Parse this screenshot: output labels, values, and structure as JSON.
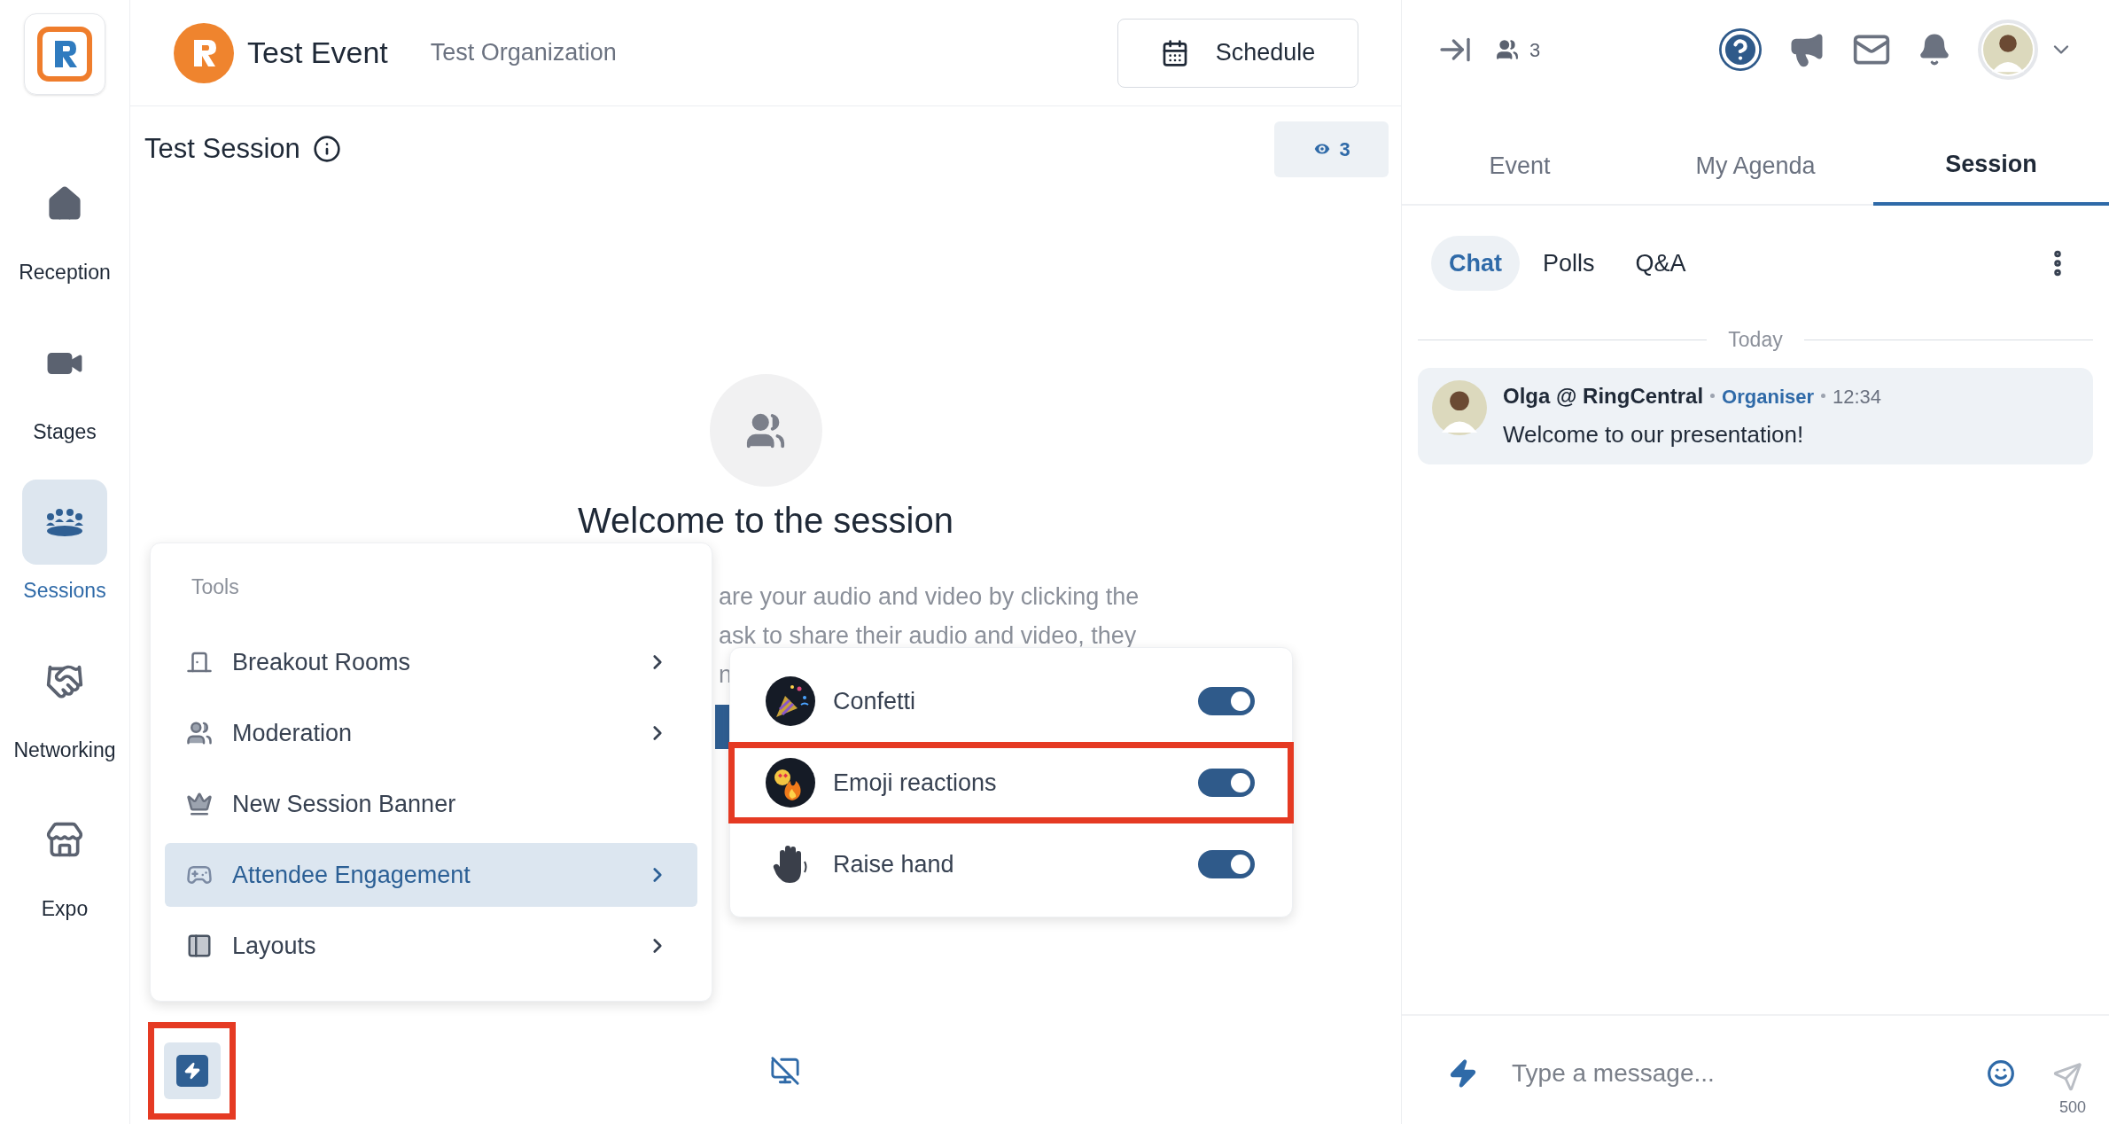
{
  "sidebar": {
    "items": [
      {
        "label": "Reception",
        "kind": "home",
        "selected": false
      },
      {
        "label": "Stages",
        "kind": "video",
        "selected": false
      },
      {
        "label": "Sessions",
        "kind": "sessions",
        "selected": true
      },
      {
        "label": "Networking",
        "kind": "handshake",
        "selected": false
      },
      {
        "label": "Expo",
        "kind": "store",
        "selected": false
      }
    ]
  },
  "header": {
    "event_title": "Test Event",
    "organization": "Test Organization",
    "schedule_button": "Schedule"
  },
  "session": {
    "title": "Test Session",
    "viewer_count": "3",
    "heading": "Welcome to the session",
    "description_lines": [
      "are your audio and video by clicking the",
      "ask to share their audio and video, they",
      "n"
    ]
  },
  "tools_menu": {
    "title": "Tools",
    "items": [
      {
        "label": "Breakout Rooms",
        "kind": "door",
        "selected": false,
        "has_submenu": true
      },
      {
        "label": "Moderation",
        "kind": "users",
        "selected": false,
        "has_submenu": true
      },
      {
        "label": "New Session Banner",
        "kind": "crown",
        "selected": false,
        "has_submenu": false
      },
      {
        "label": "Attendee Engagement",
        "kind": "gamepad",
        "selected": true,
        "has_submenu": true
      },
      {
        "label": "Layouts",
        "kind": "layout",
        "selected": false,
        "has_submenu": true
      }
    ]
  },
  "engagement_menu": {
    "items": [
      {
        "label": "Confetti",
        "kind": "confetti",
        "on": true,
        "highlighted": false
      },
      {
        "label": "Emoji reactions",
        "kind": "emoji",
        "on": true,
        "highlighted": true
      },
      {
        "label": "Raise hand",
        "kind": "hand",
        "on": true,
        "highlighted": false
      }
    ]
  },
  "bottom_bar": {
    "tools_button_highlighted": true
  },
  "right_panel": {
    "participant_count": "3",
    "tabs": [
      {
        "label": "Event",
        "selected": false
      },
      {
        "label": "My Agenda",
        "selected": false
      },
      {
        "label": "Session",
        "selected": true
      }
    ],
    "subtabs": [
      {
        "label": "Chat",
        "selected": true
      },
      {
        "label": "Polls",
        "selected": false
      },
      {
        "label": "Q&A",
        "selected": false
      }
    ],
    "date_divider": "Today",
    "messages": [
      {
        "author": "Olga @ RingCentral",
        "role": "Organiser",
        "time": "12:34",
        "text": "Welcome to our presentation!"
      }
    ],
    "composer": {
      "placeholder": "Type a message...",
      "char_limit": "500"
    }
  }
}
